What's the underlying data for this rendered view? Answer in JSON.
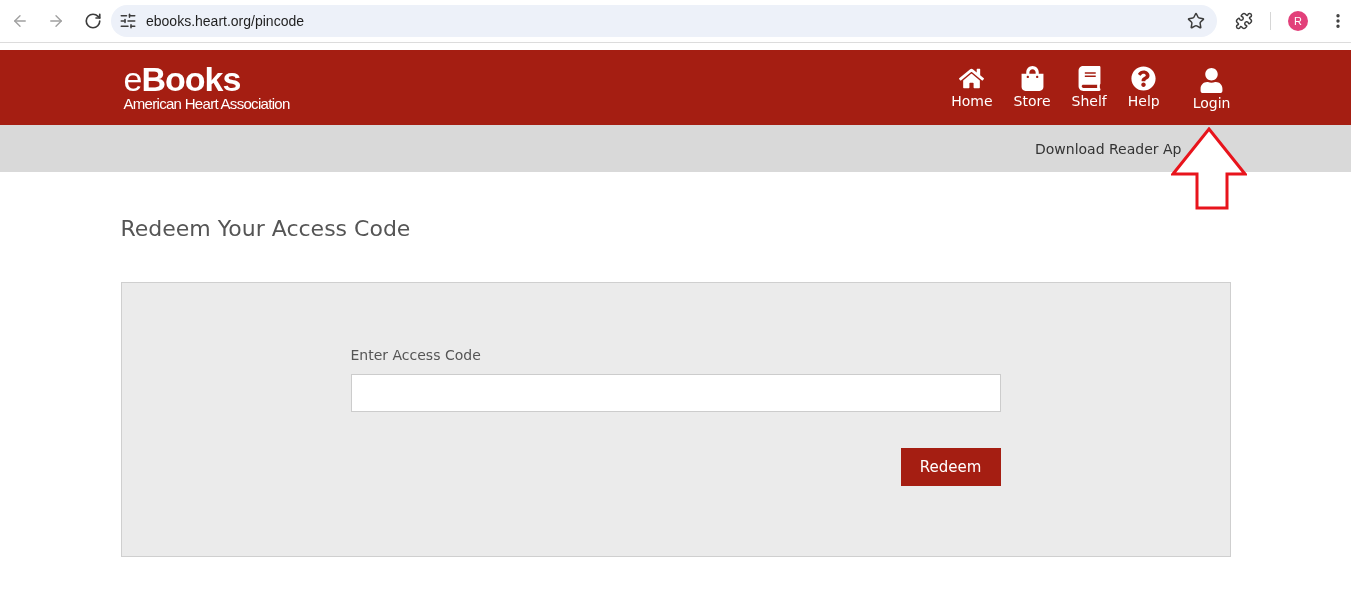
{
  "browser": {
    "url": "ebooks.heart.org/pincode",
    "avatar_letter": "R"
  },
  "header": {
    "logo_title": "e**Books**",
    "logo_subtitle": "American Heart Association",
    "nav": [
      {
        "label": "Home",
        "kind": "home"
      },
      {
        "label": "Store",
        "kind": "bag"
      },
      {
        "label": "Shelf",
        "kind": "book"
      },
      {
        "label": "Help",
        "kind": "help"
      },
      {
        "label": "Login",
        "kind": "user"
      }
    ]
  },
  "subbar": {
    "link": "Download Reader Ap"
  },
  "page": {
    "title": "Redeem Your Access Code"
  },
  "form": {
    "label": "Enter Access Code",
    "button": "Redeem"
  },
  "annotations": [
    {
      "kind": "arrow"
    }
  ]
}
